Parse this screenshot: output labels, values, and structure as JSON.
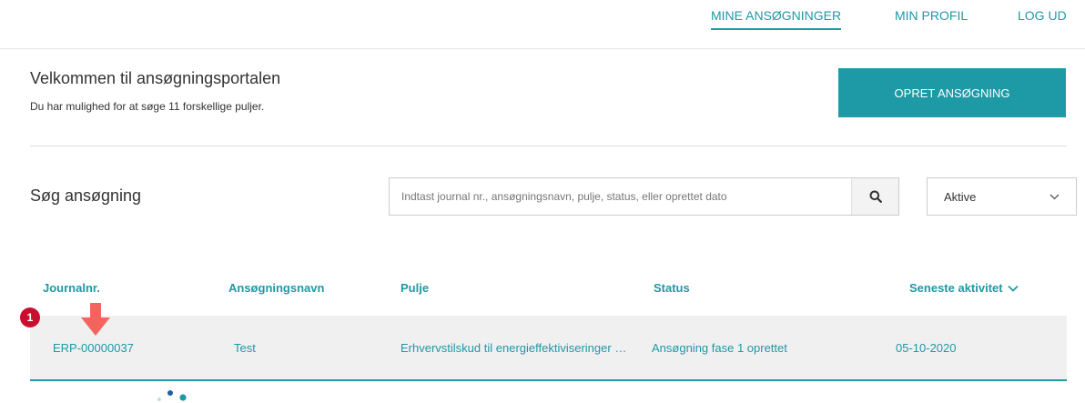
{
  "nav": {
    "mine_ansogninger": "MINE ANSØGNINGER",
    "min_profil": "MIN PROFIL",
    "log_ud": "LOG UD"
  },
  "welcome": {
    "title": "Velkommen til ansøgningsportalen",
    "subtitle": "Du har mulighed for at søge 11 forskellige puljer."
  },
  "create_button": "OPRET ANSØGNING",
  "search": {
    "title": "Søg ansøgning",
    "placeholder": "Indtast journal nr., ansøgningsnavn, pulje, status, eller oprettet dato",
    "icon": "search-icon"
  },
  "filter": {
    "selected": "Aktive",
    "icon": "chevron-down-icon"
  },
  "table": {
    "columns": [
      "Journalnr.",
      "Ansøgningsnavn",
      "Pulje",
      "Status",
      "Seneste aktivitet"
    ],
    "rows": [
      {
        "journal": "ERP-00000037",
        "navn": "Test",
        "pulje": "Erhvervstilskud til energieffektiviseringer i virksomheder",
        "status": "Ansøgning fase 1 oprettet",
        "dato": "05-10-2020"
      }
    ]
  },
  "annotation": {
    "badge_number": "1",
    "arrow_icon": "down-arrow-icon"
  },
  "colors": {
    "accent": "#1e99a6",
    "badge": "#c8102e",
    "arrow": "#f4645f",
    "row_background": "#f0f0f0"
  }
}
